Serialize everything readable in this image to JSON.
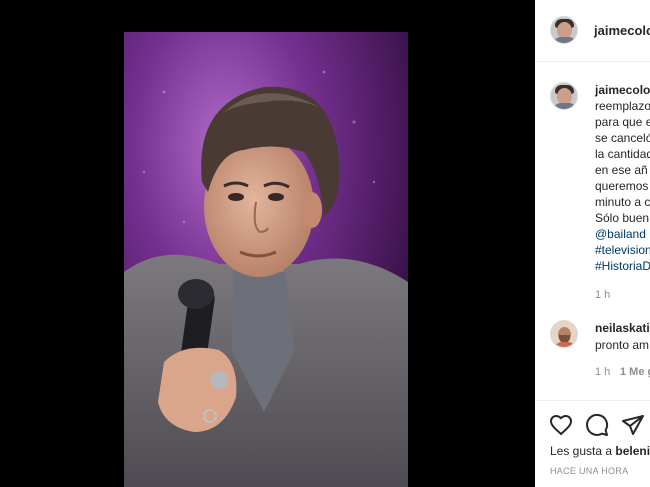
{
  "post": {
    "author": "jaimecolom",
    "image_description_icon": "person-with-microphone-photo"
  },
  "caption": {
    "author": "jaimecolom",
    "lines": [
      "reemplazo",
      "para que e",
      "se canceló",
      "la cantidad",
      "en ese añ",
      "queremos",
      "minuto a c",
      "Sólo buen"
    ],
    "links": [
      "@bailand",
      "#television",
      "#HistoriaD"
    ],
    "time": "1 h"
  },
  "reply": {
    "author": "neilaskati",
    "text": "pronto am",
    "time": "1 h",
    "likes": "1 Me g"
  },
  "actions": {
    "like_icon": "heart-icon",
    "comment_icon": "comment-icon",
    "share_icon": "paper-plane-icon"
  },
  "likes": {
    "prefix": "Les gusta a ",
    "user": "beleni"
  },
  "timestamp": "HACE UNA HORA"
}
